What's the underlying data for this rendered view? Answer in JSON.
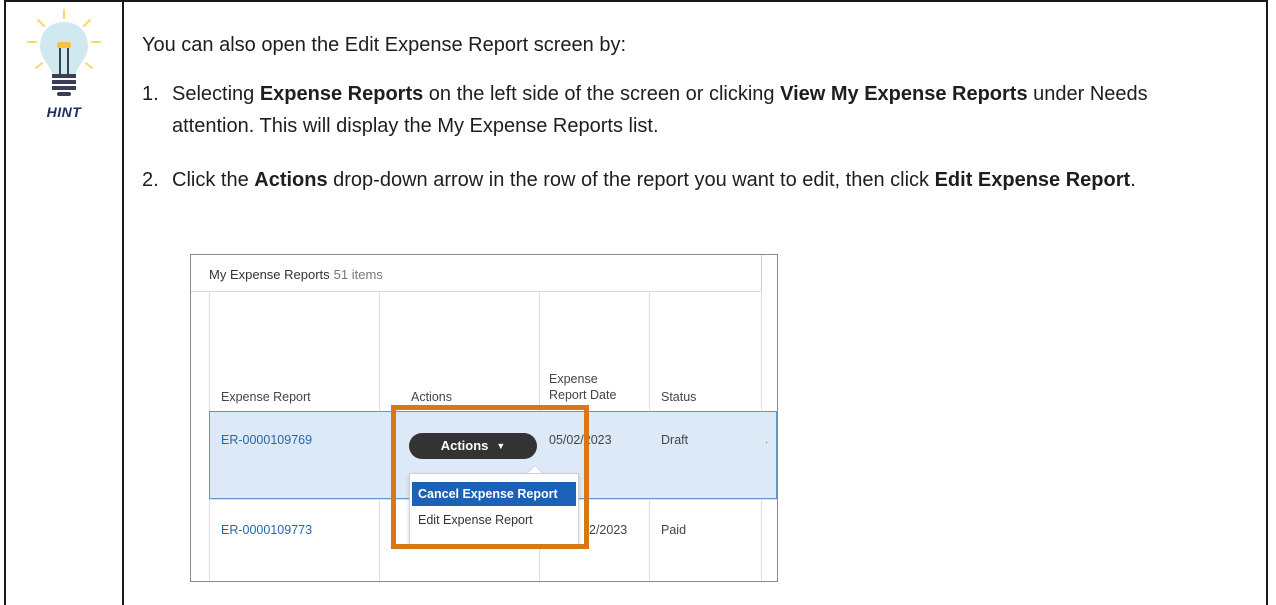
{
  "hint": {
    "label": "HINT",
    "icon": "lightbulb-icon",
    "colors": {
      "bulb": "#cfe9ef",
      "filament": "#f5c342",
      "rays": "#f7d86b",
      "label": "#1f2d5c",
      "base": "#3a3f57"
    }
  },
  "content": {
    "intro": "You can also open the Edit Expense Report screen by:",
    "step1": {
      "num": "1.",
      "pre": "Selecting ",
      "bold1": "Expense Reports",
      "mid": " on the left side of the screen or clicking ",
      "bold2": "View My Expense Reports",
      "post": " under Needs attention. This will display the My Expense Reports list."
    },
    "step2": {
      "num": "2.",
      "pre": "Click the ",
      "bold1": "Actions",
      "mid": " drop-down arrow in the row of the report you want to edit, then click ",
      "bold2": "Edit Expense Report",
      "post": "."
    }
  },
  "screenshot": {
    "title": "My Expense Reports",
    "count": "51 items",
    "columns": {
      "expense_report": "Expense Report",
      "actions": "Actions",
      "report_date_line1": "Expense",
      "report_date_line2": "Report Date",
      "status": "Status"
    },
    "rows": [
      {
        "id": "ER-0000109769",
        "date": "05/02/2023",
        "status": "Draft"
      },
      {
        "id": "ER-0000109773",
        "date": "2/2023",
        "status": "Paid"
      }
    ],
    "actions_button": "Actions",
    "menu": [
      "Cancel Expense Report",
      "Edit Expense Report"
    ],
    "highlight_color": "#d97716",
    "selected_row_color": "#dde9f6",
    "link_color": "#2767a8"
  }
}
